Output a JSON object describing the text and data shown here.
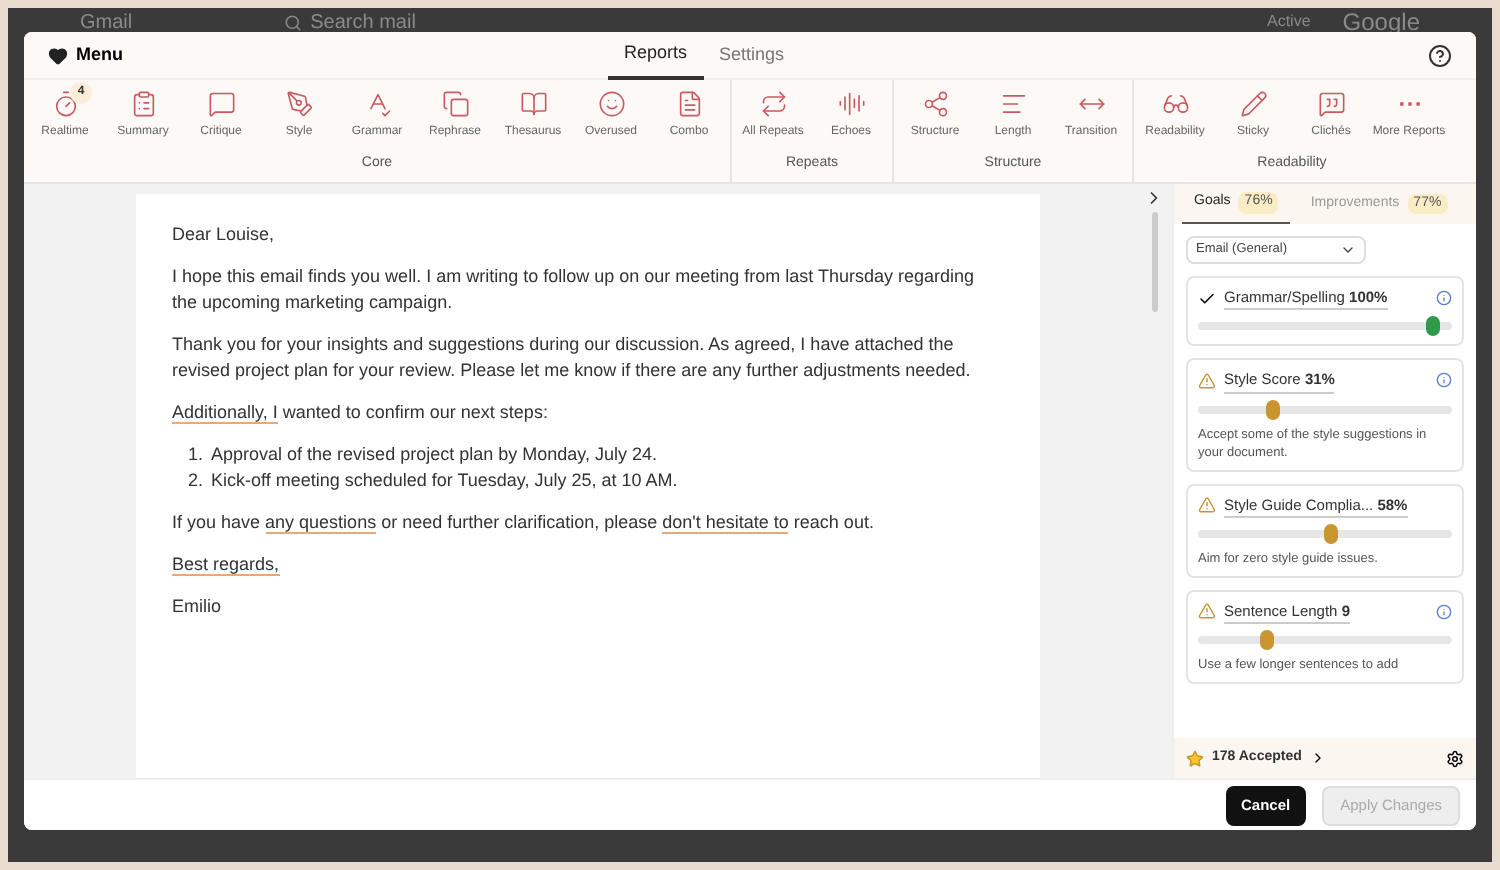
{
  "background": {
    "app_name": "Gmail",
    "search_placeholder": "Search mail",
    "status": "Active",
    "brand": "Google"
  },
  "header": {
    "menu_label": "Menu",
    "tabs": [
      {
        "label": "Reports",
        "selected": true
      },
      {
        "label": "Settings",
        "selected": false
      }
    ]
  },
  "toolbar_groups": [
    {
      "name": "Core",
      "items": [
        {
          "label": "Realtime",
          "badge": "4"
        },
        {
          "label": "Summary"
        },
        {
          "label": "Critique"
        },
        {
          "label": "Style"
        },
        {
          "label": "Grammar"
        },
        {
          "label": "Rephrase"
        },
        {
          "label": "Thesaurus"
        },
        {
          "label": "Overused"
        },
        {
          "label": "Combo"
        }
      ]
    },
    {
      "name": "Repeats",
      "items": [
        {
          "label": "All Repeats"
        },
        {
          "label": "Echoes"
        }
      ]
    },
    {
      "name": "Structure",
      "items": [
        {
          "label": "Structure"
        },
        {
          "label": "Length"
        },
        {
          "label": "Transition"
        }
      ]
    },
    {
      "name": "Readability",
      "items": [
        {
          "label": "Readability"
        },
        {
          "label": "Sticky"
        },
        {
          "label": "Clichés"
        },
        {
          "label": "More Reports"
        }
      ]
    }
  ],
  "document": {
    "blocks": [
      {
        "kind": "paragraph",
        "segments": [
          {
            "text": "Dear Louise,",
            "flagged": false
          }
        ]
      },
      {
        "kind": "paragraph",
        "segments": [
          {
            "text": "I hope this email finds you well. I am writing to follow up on our meeting from last Thursday regarding the upcoming marketing campaign.",
            "flagged": false
          }
        ]
      },
      {
        "kind": "paragraph",
        "segments": [
          {
            "text": "Thank you for your insights and suggestions during our discussion. As agreed, I have attached the revised project plan for your review. Please let me know if there are any further adjustments needed.",
            "flagged": false
          }
        ]
      },
      {
        "kind": "paragraph",
        "segments": [
          {
            "text": "Additionally, I",
            "flagged": true
          },
          {
            "text": " wanted to confirm our next steps:",
            "flagged": false
          }
        ]
      },
      {
        "kind": "list",
        "items": [
          {
            "number": "1.",
            "text": "Approval of the revised project plan by Monday, July 24."
          },
          {
            "number": "2.",
            "text": "Kick-off meeting scheduled for Tuesday, July 25, at 10 AM."
          }
        ]
      },
      {
        "kind": "paragraph",
        "segments": [
          {
            "text": "If you have ",
            "flagged": false
          },
          {
            "text": "any questions",
            "flagged": true
          },
          {
            "text": " or need further clarification, please ",
            "flagged": false
          },
          {
            "text": "don't hesitate to",
            "flagged": true
          },
          {
            "text": " reach out.",
            "flagged": false
          }
        ]
      },
      {
        "kind": "paragraph",
        "segments": [
          {
            "text": "Best regards,",
            "flagged": true
          }
        ]
      },
      {
        "kind": "paragraph",
        "segments": [
          {
            "text": "Emilio",
            "flagged": false
          }
        ]
      }
    ]
  },
  "sidebar": {
    "tabs": [
      {
        "label": "Goals",
        "value": "76%",
        "selected": true
      },
      {
        "label": "Improvements",
        "value": "77%",
        "selected": false
      }
    ],
    "dropdown": "Email (General)",
    "goals": [
      {
        "kind": "ok",
        "title": "Grammar/Spelling",
        "value": "100%",
        "level": 0.92,
        "info": true
      },
      {
        "kind": "warning",
        "title": "Style Score",
        "value": "31%",
        "level": 0.29,
        "info": true,
        "description": "Accept some of the style suggestions in your document."
      },
      {
        "kind": "warning",
        "title": "Style Guide Complia...",
        "value": "58%",
        "level": 0.52,
        "info": false,
        "description": "Aim for zero style guide issues."
      },
      {
        "kind": "warning",
        "title": "Sentence Length",
        "value": "9",
        "level": 0.27,
        "info": true,
        "description": "Use a few longer sentences to add"
      }
    ],
    "accepted": "178 Accepted"
  },
  "footer": {
    "buttons": [
      {
        "label": "Cancel",
        "disabled": false
      },
      {
        "label": "Apply Changes",
        "disabled": true
      }
    ]
  }
}
